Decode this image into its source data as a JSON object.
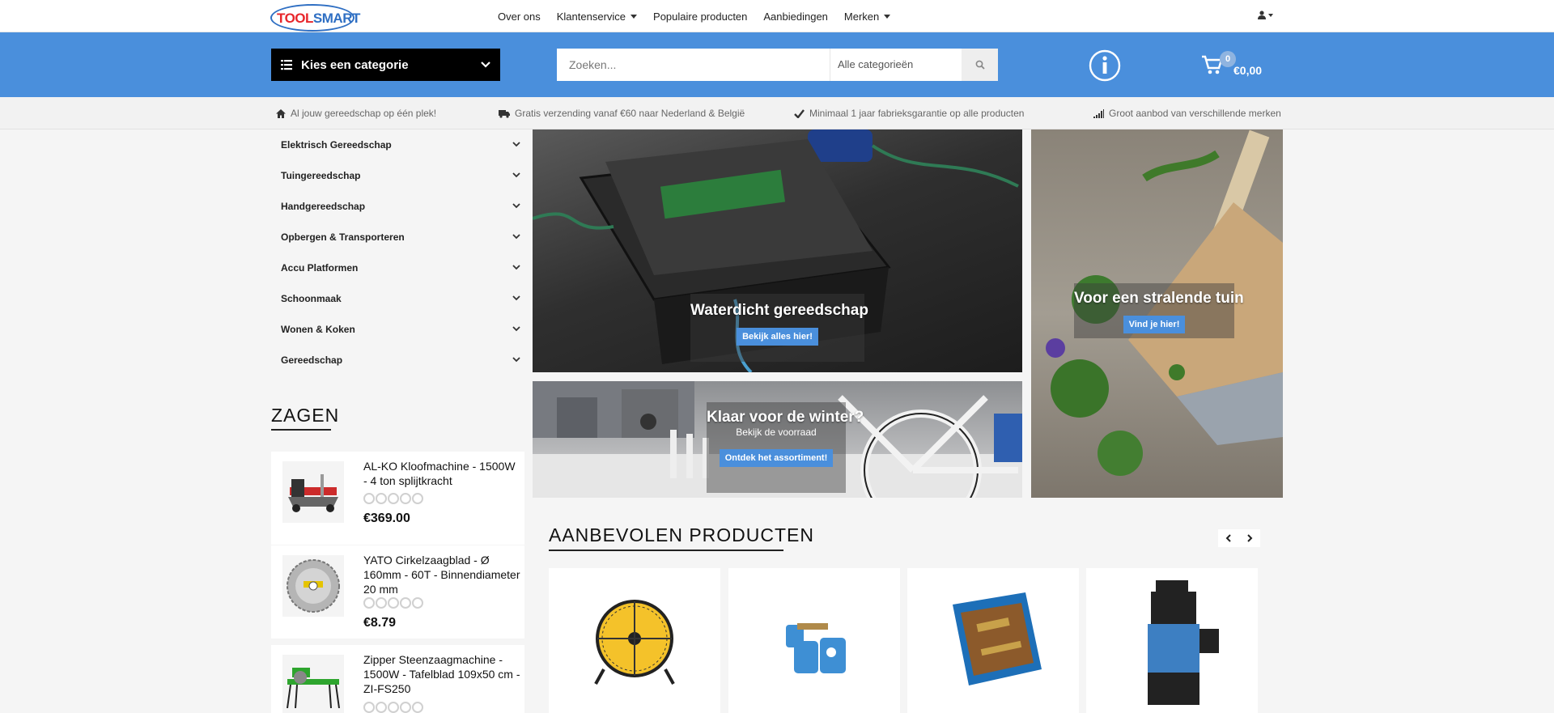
{
  "logo": {
    "part1": "TOOL",
    "part2": "SMART"
  },
  "nav": {
    "items": [
      {
        "label": "Over ons",
        "dropdown": false
      },
      {
        "label": "Klantenservice",
        "dropdown": true
      },
      {
        "label": "Populaire producten",
        "dropdown": false
      },
      {
        "label": "Aanbiedingen",
        "dropdown": false
      },
      {
        "label": "Merken",
        "dropdown": true
      }
    ],
    "user_icon": "user-icon"
  },
  "header": {
    "category_button": "Kies een categorie",
    "search": {
      "placeholder": "Zoeken...",
      "category": "Alle categorieën"
    },
    "cart": {
      "count": "0",
      "total": "€0,00"
    }
  },
  "usp": [
    {
      "icon": "home-icon",
      "text": "Al jouw gereedschap op één plek!"
    },
    {
      "icon": "truck-icon",
      "text": "Gratis verzending vanaf €60 naar Nederland & België"
    },
    {
      "icon": "check-icon",
      "text": "Minimaal 1 jaar fabrieksgarantie op alle producten"
    },
    {
      "icon": "signal-icon",
      "text": "Groot aanbod van verschillende merken"
    }
  ],
  "categories": [
    "Elektrisch Gereedschap",
    "Tuingereedschap",
    "Handgereedschap",
    "Opbergen & Transporteren",
    "Accu Platformen",
    "Schoonmaak",
    "Wonen & Koken",
    "Gereedschap"
  ],
  "sidebar_section": {
    "title": "ZAGEN",
    "products": [
      {
        "title": "AL-KO Kloofmachine - 1500W - 4 ton splijtkracht",
        "price": "€369.00",
        "rating": 0
      },
      {
        "title": "YATO Cirkelzaagblad - Ø 160mm - 60T - Binnendiameter 20 mm",
        "price": "€8.79",
        "rating": 0
      },
      {
        "title": "Zipper Steenzaagmachine - 1500W - Tafelblad 109x50 cm - ZI-FS250",
        "price": "",
        "rating": 0
      }
    ]
  },
  "banners": {
    "waterproof": {
      "title": "Waterdicht gereedschap",
      "button": "Bekijk alles hier!"
    },
    "garden": {
      "title": "Voor een stralende tuin",
      "button": "Vind je hier!"
    },
    "winter": {
      "title": "Klaar voor de winter?",
      "subtitle": "Bekijk de voorraad",
      "button": "Ontdek het assortiment!"
    }
  },
  "recommended": {
    "title": "AANBEVOLEN PRODUCTEN",
    "products": [
      {
        "image": "floor-fan"
      },
      {
        "image": "gas-burner"
      },
      {
        "image": "soldering-kit-case"
      },
      {
        "image": "submersible-pump"
      }
    ]
  },
  "colors": {
    "accent": "#4a8fdc",
    "logo_red": "#e8262b",
    "logo_blue": "#2f6fc3"
  }
}
